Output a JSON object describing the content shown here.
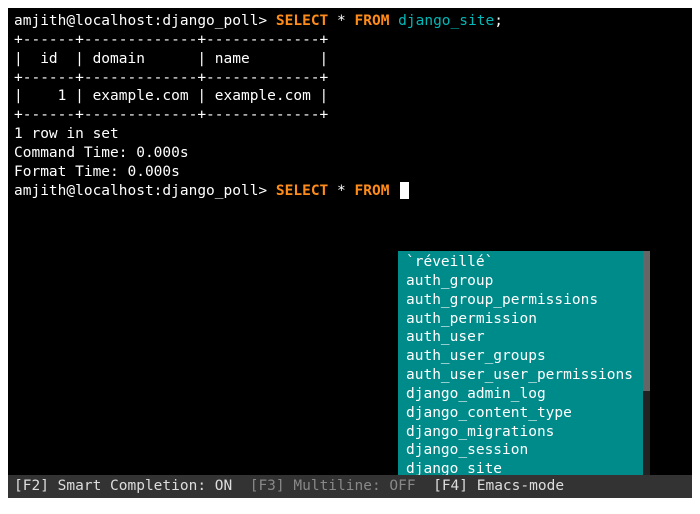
{
  "prompt1": {
    "user_host": "amjith@localhost:",
    "db": "django_poll>",
    "select": "SELECT",
    "star": "*",
    "from": "FROM",
    "table": "django_site",
    "semi": ";"
  },
  "result": {
    "border_top": "+------+-------------+-------------+",
    "header": "|  id  | domain      | name        |",
    "border_mid": "+------+-------------+-------------+",
    "row1": "|    1 | example.com | example.com |",
    "border_bot": "+------+-------------+-------------+",
    "summary": "1 row in set",
    "command_time": "Command Time: 0.000s",
    "format_time": "Format Time: 0.000s"
  },
  "prompt2": {
    "user_host": "amjith@localhost:",
    "db": "django_poll>",
    "select": "SELECT",
    "star": "*",
    "from": "FROM"
  },
  "autocomplete": [
    "`réveillé`",
    "auth_group",
    "auth_group_permissions",
    "auth_permission",
    "auth_user",
    "auth_user_groups",
    "auth_user_user_permissions",
    "django_admin_log",
    "django_content_type",
    "django_migrations",
    "django_session",
    "django_site"
  ],
  "status": {
    "f2_key": "[F2]",
    "f2_label": " Smart Completion: ",
    "f2_state": "ON",
    "f3_key": "  [F3]",
    "f3_label": " Multiline: ",
    "f3_state": "OFF",
    "f4_key": "  [F4]",
    "f4_label": " Emacs-mode"
  }
}
